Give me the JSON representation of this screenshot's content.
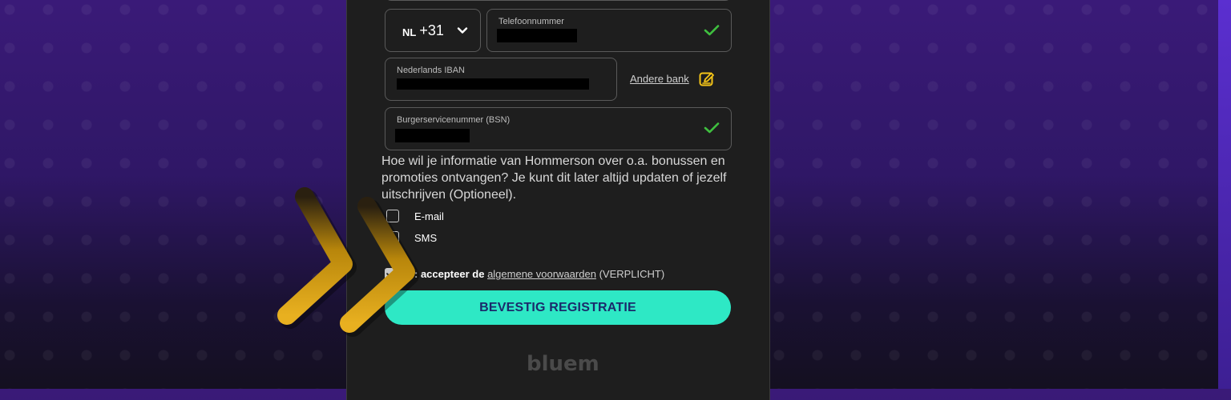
{
  "form": {
    "country_code_prefix": "NL",
    "dial_code": "+31",
    "phone_label": "Telefoonnummer",
    "iban_label": "Nederlands IBAN",
    "other_bank_link": "Andere bank",
    "bsn_label": "Burgerservicenummer (BSN)",
    "marketing_question": "Hoe wil je informatie van Hommerson over o.a. bonussen en promoties ontvangen? Je kunt dit later altijd updaten of jezelf uitschrijven (Optioneel).",
    "options": [
      {
        "label": "E-mail",
        "checked": false
      },
      {
        "label": "SMS",
        "checked": false
      }
    ],
    "terms": {
      "prefix": ": accepteer de",
      "link_text": "algemene voorwaarden",
      "suffix": "(VERPLICHT)",
      "checked": true
    },
    "submit_label": "BEVESTIG REGISTRATIE"
  },
  "footer_logo": "bluem",
  "colors": {
    "accent_button": "#2ee8c5",
    "button_text": "#1b2a6b",
    "check_green": "#3fbf3f",
    "edit_icon_yellow": "#f5c518",
    "arrow_gold": "#d9a017",
    "panel_bg": "#1e1e1e",
    "page_bg_top": "#3a1a78"
  },
  "icons": {
    "chevron": "chevron-down-icon",
    "valid": "checkmark-icon",
    "edit": "edit-icon",
    "pointer": "double-chevron-right-icon"
  }
}
